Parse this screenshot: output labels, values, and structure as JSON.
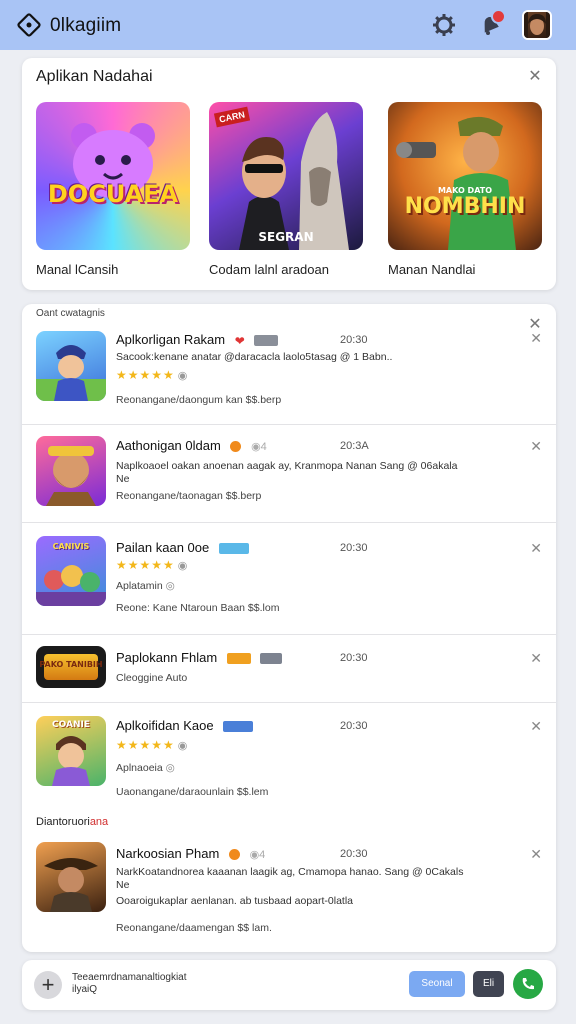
{
  "app": {
    "title": "0lkagiim"
  },
  "colors": {
    "topbar": "#a9c4f5",
    "accent_blue": "#7ba9f2",
    "star": "#f3b71a",
    "notification": "#e23b3b",
    "green": "#27a844"
  },
  "icons": {
    "brand": "diamond-outline-icon",
    "settings": "gear-icon",
    "notifications": "bell-icon",
    "close": "close-icon"
  },
  "featured": {
    "title": "Aplikan Nadahai",
    "items": [
      {
        "label": "Manal lCansih",
        "art_text": "DOCUAEA"
      },
      {
        "label": "Codam lalnl aradoan",
        "art_text": "SEGRAN",
        "tag": "CARN"
      },
      {
        "label": "Manan Nandlai",
        "art_text": "NOMBHIN",
        "art_subtext": "MAKO DATO"
      }
    ]
  },
  "list": {
    "heading": "Oant cwatagnis",
    "rows": [
      {
        "title": "Aplkorligan Rakam",
        "time": "20:30",
        "desc": "Sacook:kenane anatar @daracacla laolo5tasag @ 1 Babn..",
        "rating": "★★★★★",
        "sub": "Reonangane/daongum kan  $$.berp"
      },
      {
        "title": "Aathonigan 0ldam",
        "time": "20:3A",
        "desc": "Naplkoaoel oakan anoenan aagak ay, Kranmopa Nanan Sang @ 06akala",
        "desc2": "Ne",
        "sub": "Reonangane/taonagan $$.berp"
      },
      {
        "title": "Pailan kaan 0oe",
        "time": "20:30",
        "rating": "★★★★★",
        "sub": "Aplatamin",
        "sub2": "Reone: Kane Ntaroun Baan $$.lom",
        "art_text": "CANIVIS"
      },
      {
        "title": "Paplokann Fhlam",
        "time": "20:30",
        "sub": "Cleoggine Auto",
        "art_text": "PAKO TANIBIH"
      },
      {
        "title": "Aplkoifidan Kaoe",
        "time": "20:30",
        "rating": "★★★★★",
        "sub": "Aplnaoeia",
        "sub2": "Uaonangane/daraounlain $$.lem",
        "art_text": "COANIE"
      },
      {
        "title": "Narkoosian Pham",
        "time": "20:30",
        "desc": "NarkKoatandnorea kaaanan laagik ag, Cmamopa hanao. Sang @ 0Cakals",
        "desc2": "Ne",
        "desc3": "Ooaroigukaplar aenlanan. ab tusbaad aopart-0latla",
        "sub": "Reonangane/daamengan $$ lam."
      }
    ],
    "section": {
      "label": "Diantoruori",
      "label_red": "ana"
    }
  },
  "bottom": {
    "text": "Teeaemrdnamanaltiogkiat",
    "text2": "ilyaiQ",
    "primary_button": "Seonal",
    "dark_button": "Eli"
  }
}
